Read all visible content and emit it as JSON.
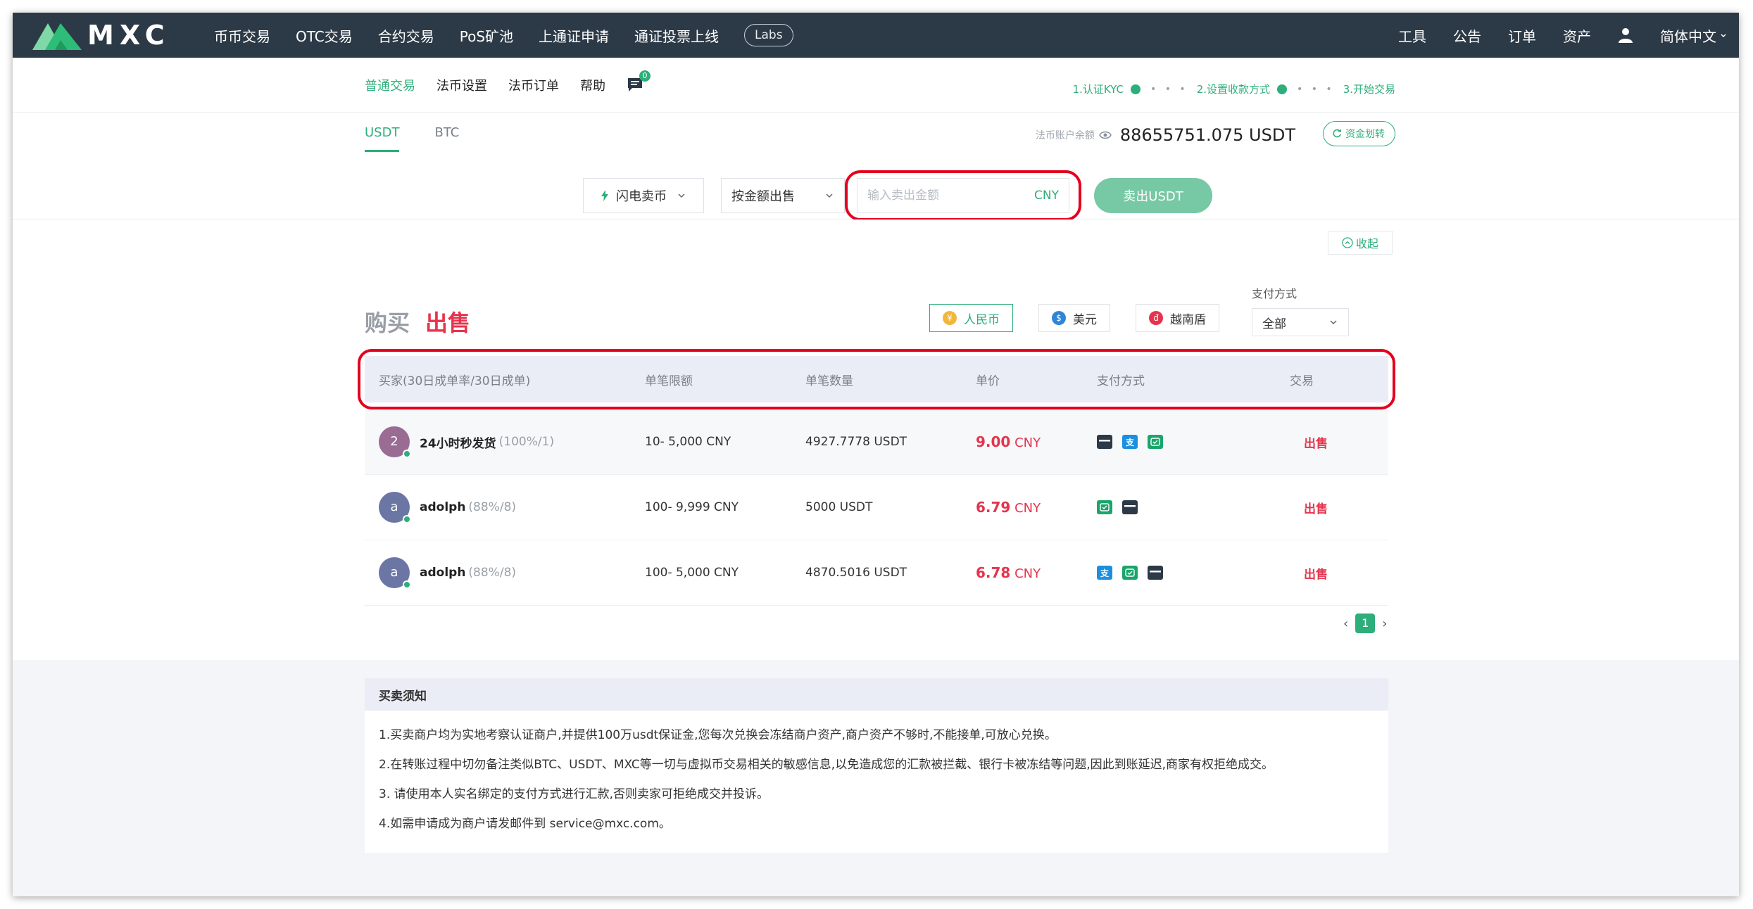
{
  "topnav": {
    "logo_text": "MXC",
    "items": [
      "币币交易",
      "OTC交易",
      "合约交易",
      "PoS矿池",
      "上通证申请",
      "通证投票上线"
    ],
    "labs": "Labs",
    "right_items": [
      "工具",
      "公告",
      "订单",
      "资产"
    ],
    "language": "简体中文"
  },
  "subnav": {
    "items": [
      "普通交易",
      "法币设置",
      "法币订单",
      "帮助"
    ],
    "message_count": "0",
    "steps": [
      "1.认证KYC",
      "2.设置收款方式",
      "3.开始交易"
    ],
    "step_dots": "• • •"
  },
  "coin_tabs": [
    "USDT",
    "BTC"
  ],
  "balance": {
    "label": "法币账户余额",
    "value": "88655751.075 USDT",
    "transfer": "资金划转"
  },
  "sell_form": {
    "flash_label": "闪电卖币",
    "mode_label": "按金额出售",
    "amount_placeholder": "输入卖出金额",
    "currency": "CNY",
    "submit": "卖出USDT"
  },
  "collapse": "收起",
  "market": {
    "buy_tab": "购买",
    "sell_tab": "出售",
    "currencies": [
      {
        "label": "人民币",
        "icon": "¥",
        "color": "#f0b73a"
      },
      {
        "label": "美元",
        "icon": "$",
        "color": "#2f86d6"
      },
      {
        "label": "越南盾",
        "icon": "đ",
        "color": "#e5344d"
      }
    ],
    "pay_filter_label": "支付方式",
    "pay_filter_value": "全部"
  },
  "table": {
    "headers": [
      "买家(30日成单率/30日成单)",
      "单笔限额",
      "单笔数量",
      "单价",
      "支付方式",
      "交易"
    ],
    "rows": [
      {
        "avatar": "2",
        "name": "24小时秒发货",
        "stat": "(100%/1)",
        "limit": "10- 5,000 CNY",
        "qty": "4927.7778 USDT",
        "price": "9.00",
        "price_unit": " CNY",
        "action": "出售"
      },
      {
        "avatar": "a",
        "name": "adolph",
        "stat": "(88%/8)",
        "limit": "100- 9,999 CNY",
        "qty": "5000 USDT",
        "price": "6.79",
        "price_unit": " CNY",
        "action": "出售"
      },
      {
        "avatar": "a",
        "name": "adolph",
        "stat": "(88%/8)",
        "limit": "100- 5,000 CNY",
        "qty": "4870.5016 USDT",
        "price": "6.78",
        "price_unit": " CNY",
        "action": "出售"
      }
    ]
  },
  "pager": {
    "prev": "‹",
    "current": "1",
    "next": "›"
  },
  "notice": {
    "title": "买卖须知",
    "lines": [
      "1.买卖商户均为实地考察认证商户,并提供100万usdt保证金,您每次兑换会冻结商户资产,商户资产不够时,不能接单,可放心兑换。",
      "2.在转账过程中切勿备注类似BTC、USDT、MXC等一切与虚拟币交易相关的敏感信息,以免造成您的汇款被拦截、银行卡被冻结等问题,因此到账延迟,商家有权拒绝成交。",
      "3. 请使用本人实名绑定的支付方式进行汇款,否则卖家可拒绝成交并投诉。",
      "4.如需申请成为商户请发邮件到 service@mxc.com。"
    ]
  }
}
